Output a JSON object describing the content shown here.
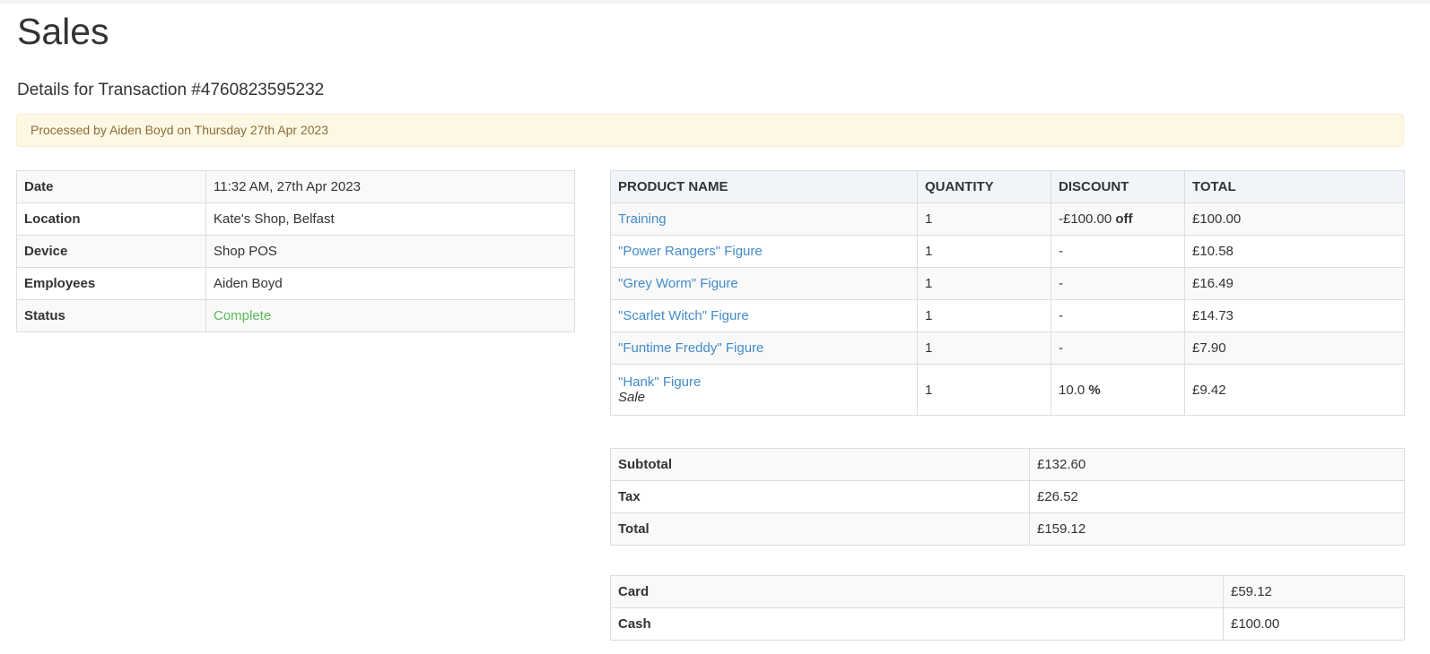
{
  "page": {
    "title": "Sales",
    "subtitle": "Details for Transaction #4760823595232",
    "alert": "Processed by Aiden Boyd on Thursday 27th Apr 2023"
  },
  "details": [
    {
      "label": "Date",
      "value": "11:32 AM, 27th Apr 2023"
    },
    {
      "label": "Location",
      "value": "Kate's Shop, Belfast"
    },
    {
      "label": "Device",
      "value": "Shop POS"
    },
    {
      "label": "Employees",
      "value": "Aiden Boyd"
    },
    {
      "label": "Status",
      "value": "Complete"
    }
  ],
  "products": {
    "headers": [
      "PRODUCT NAME",
      "QUANTITY",
      "DISCOUNT",
      "TOTAL"
    ],
    "rows": [
      {
        "name": "Training",
        "note": "",
        "qty": "1",
        "discount": "-£100.00",
        "discount_suffix": "off",
        "total": "£100.00"
      },
      {
        "name": "\"Power Rangers\" Figure",
        "note": "",
        "qty": "1",
        "discount": "-",
        "discount_suffix": "",
        "total": "£10.58"
      },
      {
        "name": "\"Grey Worm\" Figure",
        "note": "",
        "qty": "1",
        "discount": "-",
        "discount_suffix": "",
        "total": "£16.49"
      },
      {
        "name": "\"Scarlet Witch\" Figure",
        "note": "",
        "qty": "1",
        "discount": "-",
        "discount_suffix": "",
        "total": "£14.73"
      },
      {
        "name": "\"Funtime Freddy\" Figure",
        "note": "",
        "qty": "1",
        "discount": "-",
        "discount_suffix": "",
        "total": "£7.90"
      },
      {
        "name": "\"Hank\" Figure",
        "note": "Sale",
        "qty": "1",
        "discount": "10.0",
        "discount_suffix": "%",
        "total": "£9.42"
      }
    ]
  },
  "totals": [
    {
      "label": "Subtotal",
      "value": "£132.60"
    },
    {
      "label": "Tax",
      "value": "£26.52"
    },
    {
      "label": "Total",
      "value": "£159.12"
    }
  ],
  "payments": [
    {
      "label": "Card",
      "value": "£59.12"
    },
    {
      "label": "Cash",
      "value": "£100.00"
    }
  ],
  "colors": {
    "link": "#428bca",
    "status_complete": "#5cb85c",
    "alert_bg": "#fcf8e3",
    "alert_text": "#8a6d3b"
  }
}
